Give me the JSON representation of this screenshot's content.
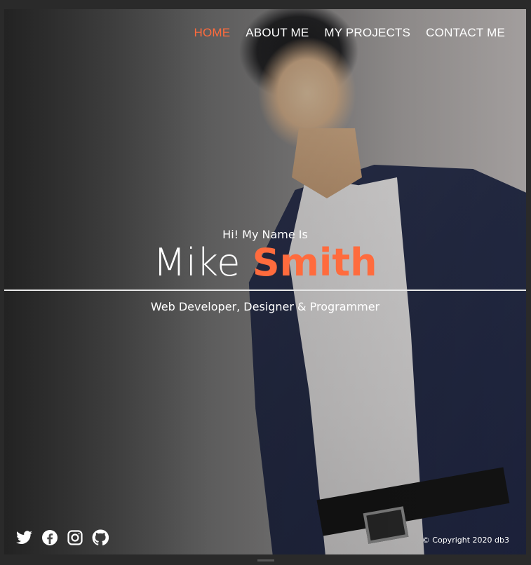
{
  "nav": {
    "items": [
      {
        "label": "HOME",
        "active": true
      },
      {
        "label": "ABOUT ME",
        "active": false
      },
      {
        "label": "MY PROJECTS",
        "active": false
      },
      {
        "label": "CONTACT ME",
        "active": false
      }
    ]
  },
  "hero": {
    "greeting": "Hi! My Name Is",
    "first_name": "Mike",
    "last_name": "Smith",
    "subtitle": "Web Developer, Designer & Programmer"
  },
  "social": {
    "icons": [
      "twitter-icon",
      "facebook-icon",
      "instagram-icon",
      "github-icon"
    ]
  },
  "footer": {
    "copyright": "© Copyright 2020 db3"
  },
  "colors": {
    "accent": "#ff6b3d",
    "text": "#ffffff"
  }
}
